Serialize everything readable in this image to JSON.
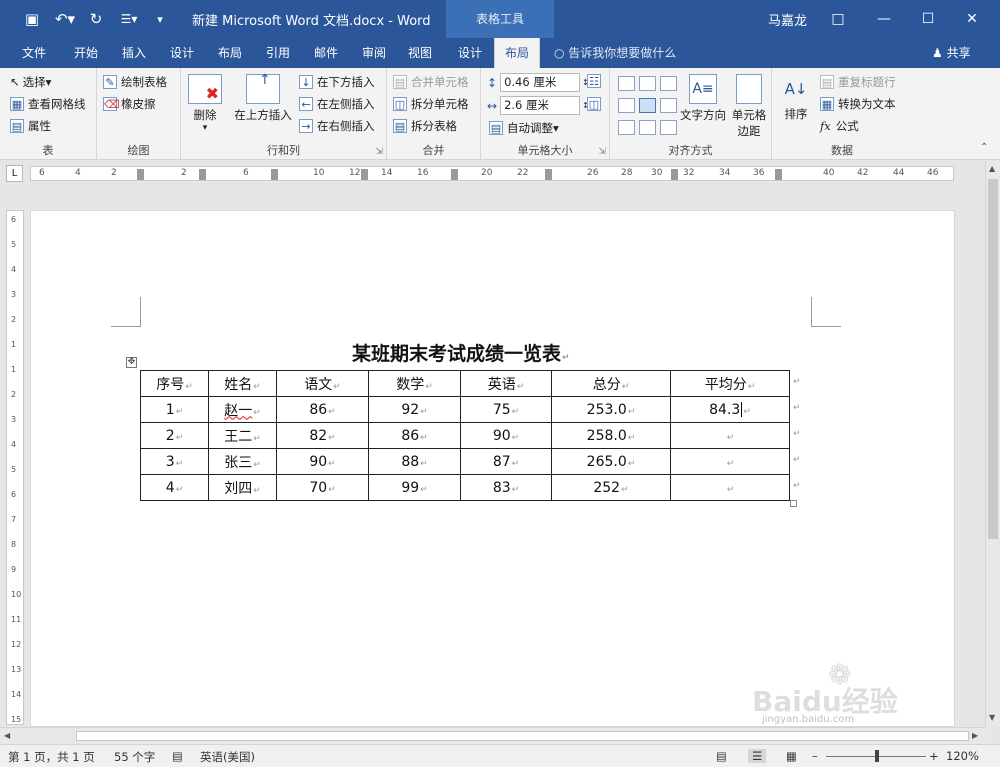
{
  "title_bar": {
    "doc_title": "新建 Microsoft Word 文档.docx  -  Word",
    "context_tab_title": "表格工具",
    "user_name": "马嘉龙"
  },
  "tabs": [
    "文件",
    "开始",
    "插入",
    "设计",
    "布局",
    "引用",
    "邮件",
    "审阅",
    "视图",
    "设计",
    "布局"
  ],
  "active_tab_index": 10,
  "tell_me": "告诉我你想要做什么",
  "share": "共享",
  "ribbon": {
    "table_group": {
      "label": "表",
      "select": "选择",
      "view_gridlines": "查看网格线",
      "properties": "属性"
    },
    "draw_group": {
      "label": "绘图",
      "draw_table": "绘制表格",
      "eraser": "橡皮擦"
    },
    "rows_cols_group": {
      "label": "行和列",
      "delete": "删除",
      "insert_above": "在上方插入",
      "insert_below": "在下方插入",
      "insert_left": "在左侧插入",
      "insert_right": "在右侧插入"
    },
    "merge_group": {
      "label": "合并",
      "merge_cells": "合并单元格",
      "split_cells": "拆分单元格",
      "split_table": "拆分表格"
    },
    "cell_size_group": {
      "label": "单元格大小",
      "height": "0.46 厘米",
      "width": "2.6 厘米",
      "autofit": "自动调整"
    },
    "alignment_group": {
      "label": "对齐方式",
      "text_direction": "文字方向",
      "cell_margins_1": "单元格",
      "cell_margins_2": "边距"
    },
    "data_group": {
      "label": "数据",
      "sort": "排序",
      "repeat_header": "重复标题行",
      "convert_to_text": "转换为文本",
      "formula": "公式"
    }
  },
  "ruler": {
    "h_labels": [
      "6",
      "4",
      "2",
      "2",
      "6",
      "10",
      "12",
      "14",
      "16",
      "20",
      "22",
      "26",
      "28",
      "30",
      "32",
      "34",
      "36",
      "40",
      "42",
      "44",
      "46"
    ],
    "v_labels": [
      "6",
      "5",
      "4",
      "3",
      "2",
      "1",
      "1",
      "2",
      "3",
      "4",
      "5",
      "6",
      "7",
      "8",
      "9",
      "10",
      "11",
      "12",
      "13",
      "14",
      "15"
    ]
  },
  "document": {
    "heading": "某班期末考试成绩一览表",
    "table": {
      "headers": [
        "序号",
        "姓名",
        "语文",
        "数学",
        "英语",
        "总分",
        "平均分"
      ],
      "rows": [
        [
          "1",
          "赵一",
          "86",
          "92",
          "75",
          "253.0",
          "84.3"
        ],
        [
          "2",
          "王二",
          "82",
          "86",
          "90",
          "258.0",
          ""
        ],
        [
          "3",
          "张三",
          "90",
          "88",
          "87",
          "265.0",
          ""
        ],
        [
          "4",
          "刘四",
          "70",
          "99",
          "83",
          "252",
          ""
        ]
      ]
    }
  },
  "status_bar": {
    "page": "第 1 页，共 1 页",
    "words": "55 个字",
    "language": "英语(美国)",
    "zoom": "120%"
  },
  "watermark": {
    "brand": "Baidu经验",
    "url": "jingyan.baidu.com"
  }
}
